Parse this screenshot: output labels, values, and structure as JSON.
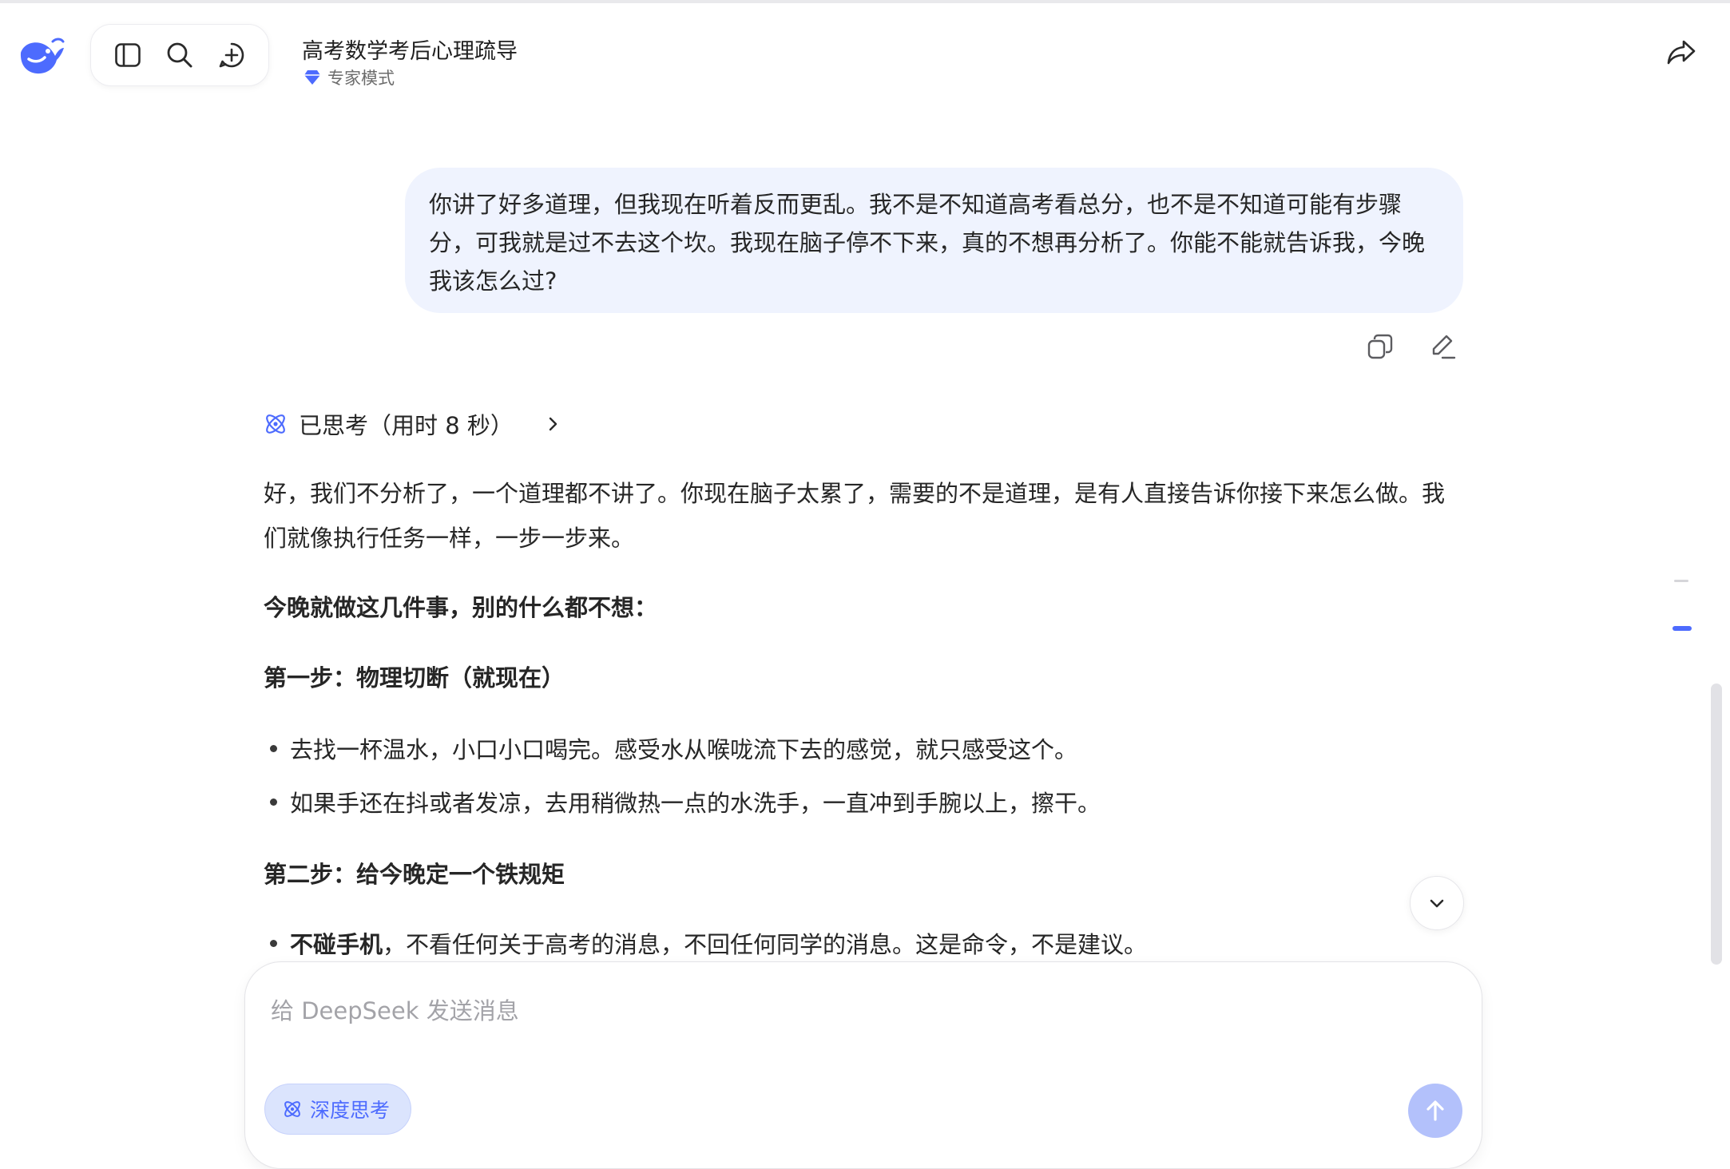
{
  "header": {
    "title": "高考数学考后心理疏导",
    "mode_label": "专家模式",
    "icons": [
      "deepseek-whale-logo",
      "sidebar-toggle-icon",
      "search-icon",
      "new-chat-icon",
      "share-icon"
    ]
  },
  "user_message": {
    "text": "你讲了好多道理，但我现在听着反而更乱。我不是不知道高考看总分，也不是不知道可能有步骤分，可我就是过不去这个坎。我现在脑子停不下来，真的不想再分析了。你能不能就告诉我，今晚我该怎么过?",
    "actions": [
      "copy-icon",
      "edit-icon"
    ]
  },
  "thinking": {
    "label": "已思考（用时 8 秒）"
  },
  "answer": {
    "intro": "好，我们不分析了，一个道理都不讲了。你现在脑子太累了，需要的不是道理，是有人直接告诉你接下来怎么做。我们就像执行任务一样，一步一步来。",
    "lead": "今晚就做这几件事，别的什么都不想：",
    "step1_heading": "第一步：物理切断（就现在）",
    "step1_items": [
      "去找一杯温水，小口小口喝完。感受水从喉咙流下去的感觉，就只感受这个。",
      "如果手还在抖或者发凉，去用稍微热一点的水洗手，一直冲到手腕以上，擦干。"
    ],
    "step2_heading": "第二步：给今晚定一个铁规矩",
    "step2_item_bold": "不碰手机",
    "step2_item_rest": "，不看任何关于高考的消息，不回任何同学的消息。这是命令，不是建议。"
  },
  "composer": {
    "placeholder": "给 DeepSeek 发送消息",
    "deep_think_label": "深度思考"
  },
  "colors": {
    "accent": "#4d6bfe",
    "user_bubble": "#eff3fe",
    "send_disabled": "#b3c1fb"
  }
}
